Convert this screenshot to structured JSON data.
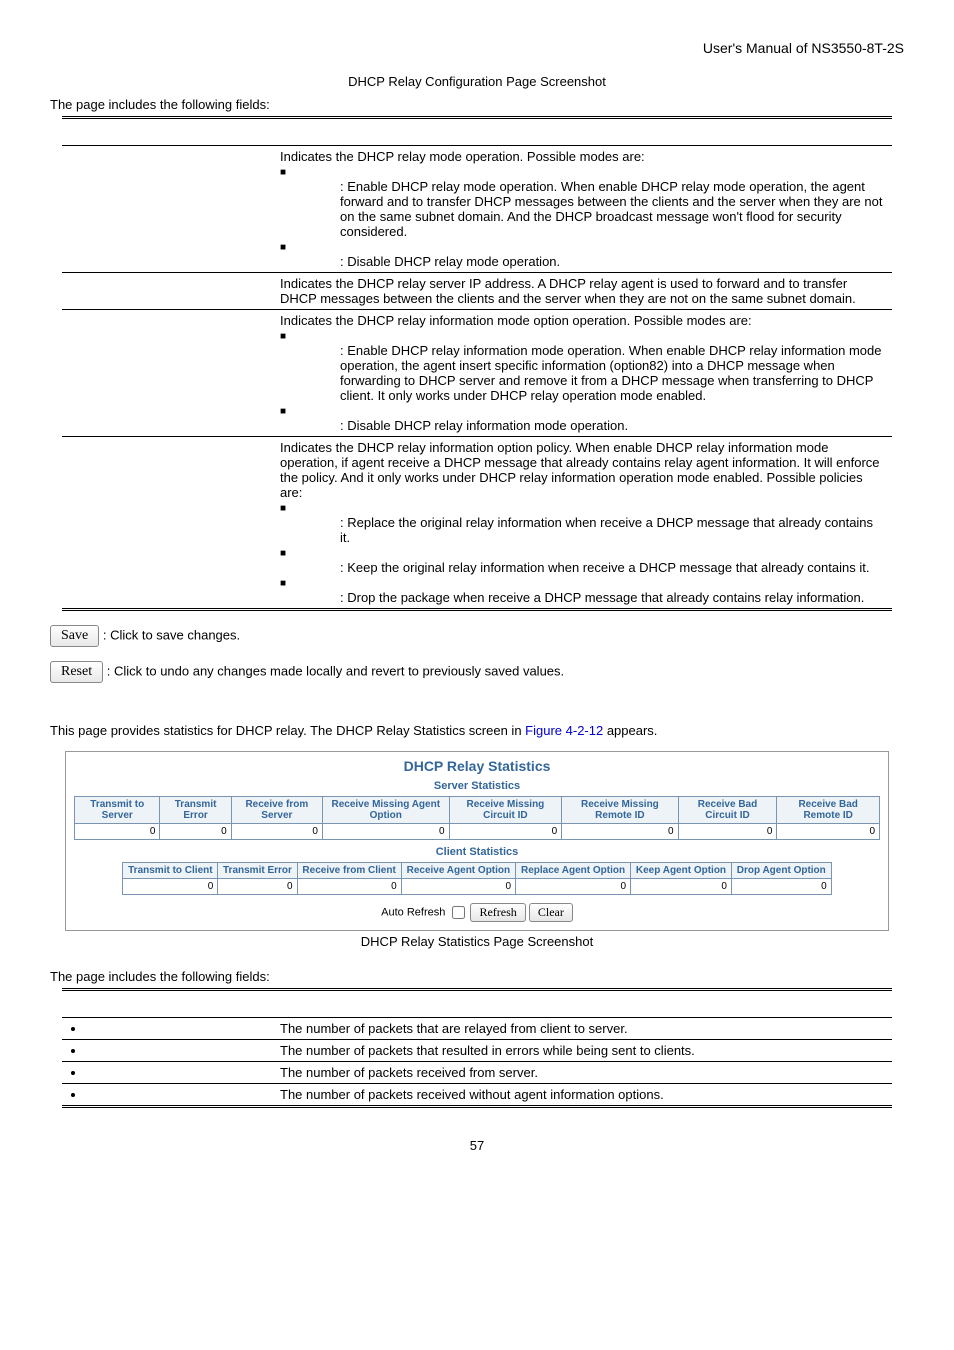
{
  "header_right": "User's Manual of NS3550-8T-2S",
  "caption1": "DHCP Relay Configuration Page Screenshot",
  "intro1": "The page includes the following fields:",
  "table1": {
    "rows": [
      {
        "desc_intro": "Indicates the DHCP relay mode operation. Possible modes are:",
        "bullets": [
          ": Enable DHCP relay mode operation. When enable DHCP relay mode operation, the agent forward and to transfer DHCP messages between the clients and the server when they are not on the same subnet domain. And the DHCP broadcast message won't flood for security considered.",
          ": Disable DHCP relay mode operation."
        ]
      },
      {
        "desc_text": "Indicates the DHCP relay server IP address. A DHCP relay agent is used to forward and to transfer DHCP messages between the clients and the server when they are not on the same subnet domain."
      },
      {
        "desc_intro": "Indicates the DHCP relay information mode option operation. Possible modes are:",
        "bullets": [
          ": Enable DHCP relay information mode operation. When enable DHCP relay information mode operation, the agent insert specific information (option82) into a DHCP message when forwarding to DHCP server and remove it from a DHCP message when transferring to DHCP client. It only works under DHCP relay operation mode enabled.",
          ": Disable DHCP relay information mode operation."
        ]
      },
      {
        "desc_intro": "Indicates the DHCP relay information option policy. When enable DHCP relay information mode operation, if agent receive a DHCP message that already contains relay agent information. It will enforce the policy. And it only works under DHCP relay information operation mode enabled. Possible policies are:",
        "bullets": [
          ": Replace the original relay information when receive a DHCP message that already contains it.",
          ": Keep the original relay information when receive a DHCP message that already contains it.",
          ": Drop the package when receive a DHCP message that already contains relay information."
        ]
      }
    ]
  },
  "buttons": {
    "save": "Save",
    "save_desc": ": Click to save changes.",
    "reset": "Reset",
    "reset_desc": ": Click to undo any changes made locally and revert to previously saved values."
  },
  "section2": {
    "para_pre": "This page provides statistics for DHCP relay. The DHCP Relay Statistics screen in ",
    "link": "Figure 4-2-12",
    "para_post": " appears.",
    "title": "DHCP Relay Statistics",
    "server_sub": "Server Statistics",
    "client_sub": "Client Statistics",
    "server_headers": [
      "Transmit to Server",
      "Transmit Error",
      "Receive from Server",
      "Receive Missing Agent Option",
      "Receive Missing Circuit ID",
      "Receive Missing Remote ID",
      "Receive Bad Circuit ID",
      "Receive Bad Remote ID"
    ],
    "server_values": [
      "0",
      "0",
      "0",
      "0",
      "0",
      "0",
      "0",
      "0"
    ],
    "client_headers": [
      "Transmit to Client",
      "Transmit Error",
      "Receive from Client",
      "Receive Agent Option",
      "Replace Agent Option",
      "Keep Agent Option",
      "Drop Agent Option"
    ],
    "client_values": [
      "0",
      "0",
      "0",
      "0",
      "0",
      "0",
      "0"
    ],
    "auto_refresh": "Auto Refresh",
    "refresh_btn": "Refresh",
    "clear_btn": "Clear",
    "caption": "DHCP Relay Statistics Page Screenshot"
  },
  "intro2": "The page includes the following fields:",
  "table2": {
    "rows": [
      {
        "desc": "The number of packets that are relayed from client to server."
      },
      {
        "desc": "The number of packets that resulted in errors while being sent to clients."
      },
      {
        "desc": "The number of packets received from server."
      },
      {
        "desc": "The number of packets received without agent information options."
      }
    ]
  },
  "page_num": "57"
}
